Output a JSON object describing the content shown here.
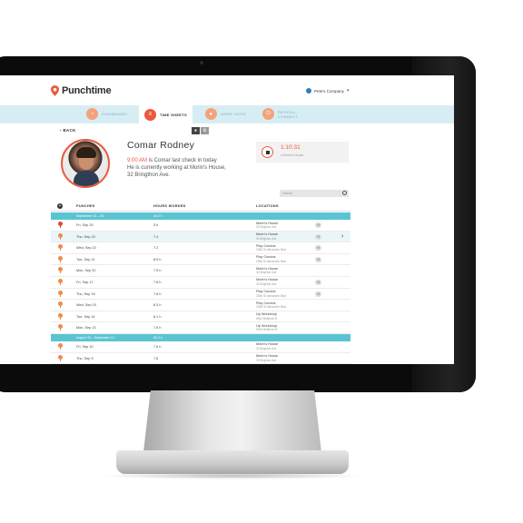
{
  "app": {
    "name": "Punchtime",
    "company": "Pete's Company"
  },
  "nav": [
    {
      "label": "DASHBOARD",
      "icon": "dashboard-icon",
      "active": false
    },
    {
      "label": "TIME SHEETS",
      "icon": "list-icon",
      "active": true
    },
    {
      "label": "WORK SITES",
      "icon": "pin-icon",
      "active": false
    },
    {
      "label_line1": "PAYROLL",
      "label_line2": "CONNECT",
      "icon": "payroll-icon",
      "active": false
    }
  ],
  "profile": {
    "back_label": "BACK",
    "name": "Comar Rodney",
    "status_time": "9:00 AM",
    "status_line1": " is Comar last check in today",
    "status_line2": "He is currently working at Morin's House,",
    "status_line3": "32 Bringthon Ave."
  },
  "clock": {
    "time": "1:10:31",
    "location": "Morin's House"
  },
  "search": {
    "placeholder": "Search"
  },
  "table": {
    "headers": {
      "punches": "PUNCHES",
      "hours": "HOURS WORKED",
      "locations": "LOCATIONS"
    },
    "groups": [
      {
        "week": "September 13 – 28",
        "total": "26.2 h",
        "rows": [
          {
            "day": "Fri, Sep 24",
            "hours": "3 h",
            "loc": "Morin's House",
            "addr": "32 Brighton Ave",
            "plus": "+1",
            "active": true
          },
          {
            "day": "Thu, Sep 23",
            "hours": "7.4",
            "loc": "Morin's House",
            "addr": "32 Brighton Ave",
            "plus": "+1",
            "highlight": true
          },
          {
            "day": "Wed, Sep 22",
            "hours": "7.2",
            "loc": "Play Condos",
            "addr": "2356 St Alexander Blvd",
            "plus": "+1"
          },
          {
            "day": "Tue, Sep 21",
            "hours": "8.5 h",
            "loc": "Play Condos",
            "addr": "2356 St Alexander Blvd",
            "plus": "+1"
          },
          {
            "day": "Mon, Sep 20",
            "hours": "7.5 h",
            "loc": "Morin's House",
            "addr": "32 Brighton Ave",
            "plus": ""
          },
          {
            "day": "Fri, Sep 17",
            "hours": "7.6 h",
            "loc": "Morin's House",
            "addr": "32 Brighton Ave",
            "plus": "+1"
          },
          {
            "day": "Thu, Sep 16",
            "hours": "7.8 h",
            "loc": "Play Condos",
            "addr": "2356 St Alexander Blvd",
            "plus": "+1"
          },
          {
            "day": "Wed, Sep 15",
            "hours": "8.3 h",
            "loc": "Play Condos",
            "addr": "2356 St Alexander Blvd",
            "plus": ""
          },
          {
            "day": "Tue, Sep 14",
            "hours": "8.1 h",
            "loc": "Up Workshop",
            "addr": "5943 Bellbeat St",
            "plus": ""
          },
          {
            "day": "Mon, Sep 13",
            "hours": "7.6 h",
            "loc": "Up Workshop",
            "addr": "5943 Bellbeat St",
            "plus": ""
          }
        ]
      },
      {
        "week": "August 30 – September 12",
        "total": "60.2 h",
        "rows": [
          {
            "day": "Fri, Sep 10",
            "hours": "7.6 h",
            "loc": "Morin's House",
            "addr": "32 Brighton Ave",
            "plus": ""
          },
          {
            "day": "Thu, Sep 9",
            "hours": "7.6",
            "loc": "Morin's House",
            "addr": "32 Brighton Ave",
            "plus": ""
          }
        ]
      }
    ]
  },
  "colors": {
    "accent": "#ea5a3c",
    "teal": "#5bc4d2",
    "nav_bg": "#d6eef3"
  }
}
